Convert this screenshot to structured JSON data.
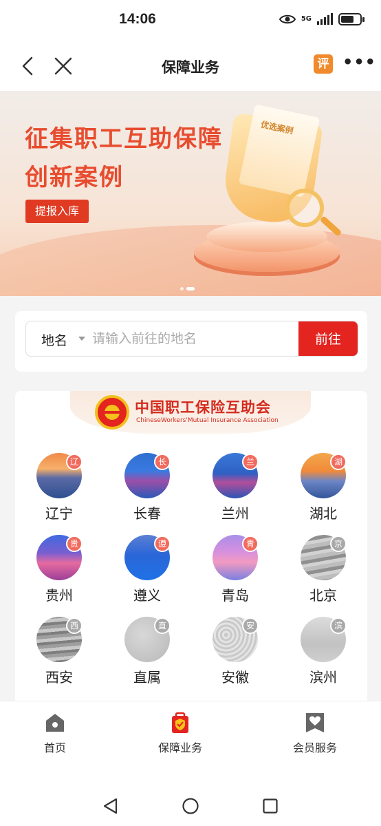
{
  "status_bar": {
    "time": "14:06",
    "network": "5G"
  },
  "header": {
    "title": "保障业务",
    "review_label": "评",
    "more_label": "•••"
  },
  "banner": {
    "headline_line1": "征集职工互助保障",
    "headline_line2": "创新案例",
    "button_label": "提报入库",
    "document_label": "优选案例"
  },
  "search": {
    "select_label": "地名",
    "placeholder": "请输入前往的地名",
    "go_label": "前往"
  },
  "association": {
    "name_cn": "中国职工保险互助会",
    "name_en": "ChineseWorkers'Mutual Insurance Association"
  },
  "regions": [
    {
      "name": "辽宁",
      "badge": "辽",
      "badge_color": "#f06b5e",
      "image": "img-a"
    },
    {
      "name": "长春",
      "badge": "长",
      "badge_color": "#f06b5e",
      "image": "img-b"
    },
    {
      "name": "兰州",
      "badge": "兰",
      "badge_color": "#f06b5e",
      "image": "img-c"
    },
    {
      "name": "湖北",
      "badge": "湖",
      "badge_color": "#f06b5e",
      "image": "img-d"
    },
    {
      "name": "贵州",
      "badge": "贵",
      "badge_color": "#f06b5e",
      "image": "img-e"
    },
    {
      "name": "遵义",
      "badge": "遵",
      "badge_color": "#f06b5e",
      "image": "img-f"
    },
    {
      "name": "青岛",
      "badge": "青",
      "badge_color": "#f06b5e",
      "image": "img-g"
    },
    {
      "name": "北京",
      "badge": "京",
      "badge_color": "#a9a9a9",
      "image": "img-h"
    },
    {
      "name": "西安",
      "badge": "西",
      "badge_color": "#a9a9a9",
      "image": "img-i"
    },
    {
      "name": "直属",
      "badge": "直",
      "badge_color": "#a9a9a9",
      "image": "img-j"
    },
    {
      "name": "安徽",
      "badge": "安",
      "badge_color": "#a9a9a9",
      "image": "img-k"
    },
    {
      "name": "滨州",
      "badge": "滨",
      "badge_color": "#a9a9a9",
      "image": "img-l"
    }
  ],
  "tabbar": {
    "items": [
      {
        "label": "首页",
        "icon": "home-icon"
      },
      {
        "label": "保障业务",
        "icon": "shield-bag-icon",
        "active": true
      },
      {
        "label": "会员服务",
        "icon": "member-heart-icon"
      }
    ]
  },
  "colors": {
    "accent": "#e3241f",
    "brand_orange": "#f08a2c"
  }
}
